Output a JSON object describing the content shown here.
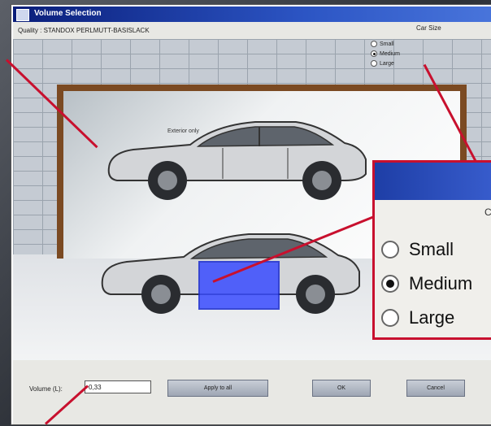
{
  "window": {
    "title": "Volume Selection"
  },
  "quality": {
    "text": "Quality : STANDOX PERLMUTT-BASISLACK"
  },
  "carsize": {
    "title": "Car Size",
    "options": [
      {
        "label": "Small",
        "selected": false
      },
      {
        "label": "Medium",
        "selected": true
      },
      {
        "label": "Large",
        "selected": false
      }
    ]
  },
  "scene": {
    "exterior_label": "Exterior only"
  },
  "volume": {
    "label": "Volume (L):",
    "value": "0,33"
  },
  "buttons": {
    "apply": "Apply to all",
    "ok": "OK",
    "cancel": "Cancel"
  },
  "zoom": {
    "group_label": "C",
    "options": [
      "Small",
      "Medium",
      "Large"
    ],
    "selected_index": 1
  },
  "colors": {
    "accent_red": "#c8102e",
    "title_blue": "#1e3ea6",
    "door_blue": "#3a4cff"
  }
}
